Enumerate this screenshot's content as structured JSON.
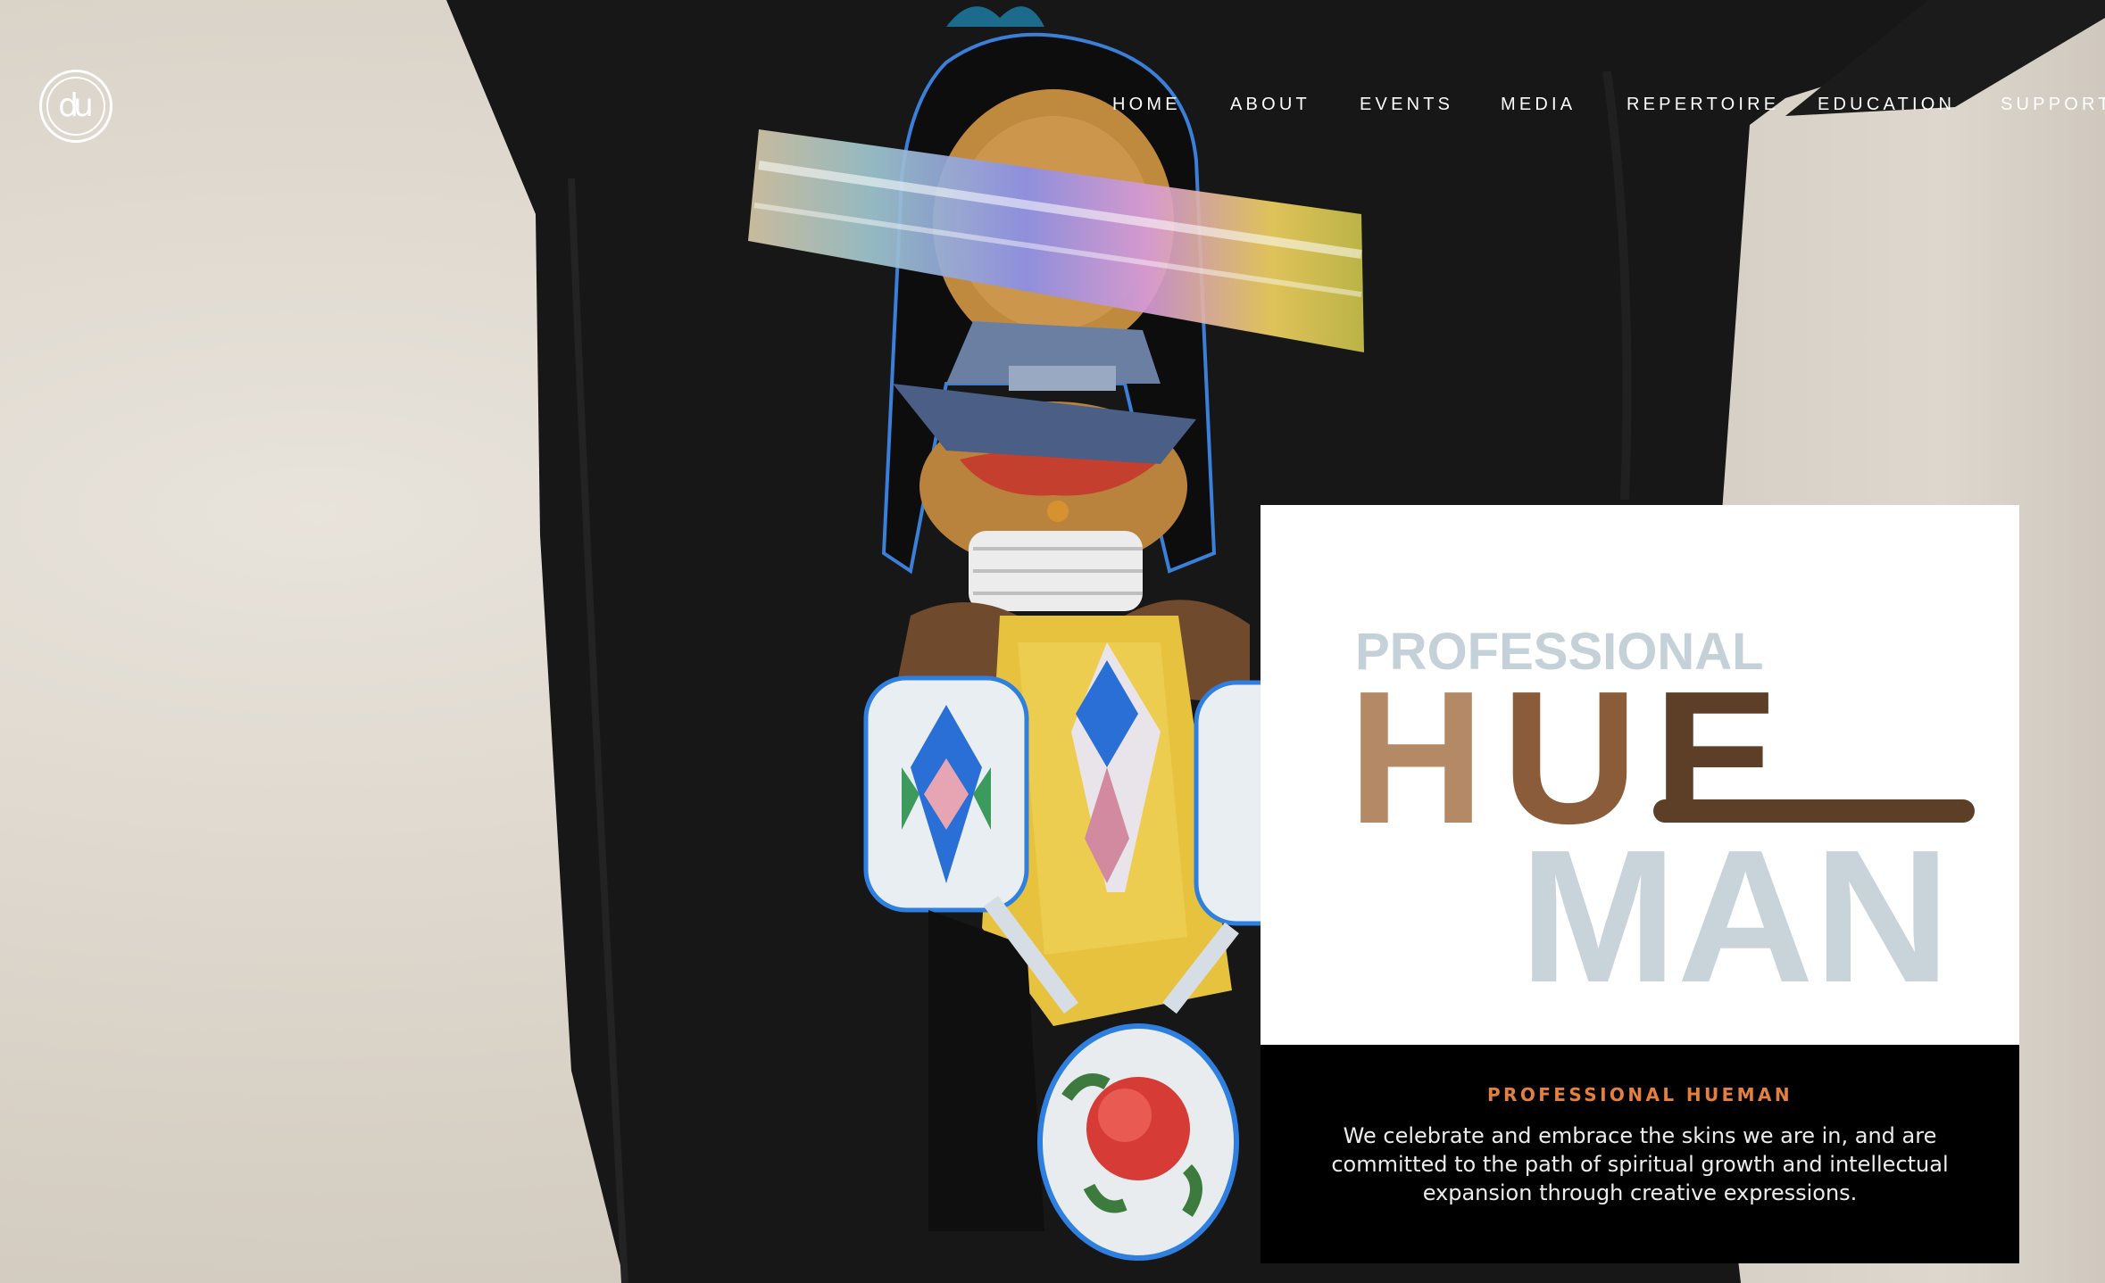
{
  "logo": {
    "alt": "du"
  },
  "nav": {
    "items": [
      {
        "label": "HOME"
      },
      {
        "label": "ABOUT"
      },
      {
        "label": "EVENTS"
      },
      {
        "label": "MEDIA"
      },
      {
        "label": "REPERTOIRE"
      },
      {
        "label": "EDUCATION"
      },
      {
        "label": "SUPPORT"
      }
    ]
  },
  "feature": {
    "graphic": {
      "line1": "PROFESSIONAL",
      "line2": "HUE",
      "line3": "MAN",
      "colors": {
        "professional": "#c5d1d8",
        "h": "#b48a66",
        "u": "#8a5c3a",
        "e": "#5d3f28",
        "man": "#c9d4da"
      }
    },
    "kicker": "PROFESSIONAL HUEMAN",
    "body": "We celebrate and embrace the skins we are in, and are committed to the path of spiritual growth and intellectual expansion through creative expressions."
  },
  "colors": {
    "accent": "#e3803d",
    "shirt": "#161716",
    "wall": "#dcd6cd"
  }
}
